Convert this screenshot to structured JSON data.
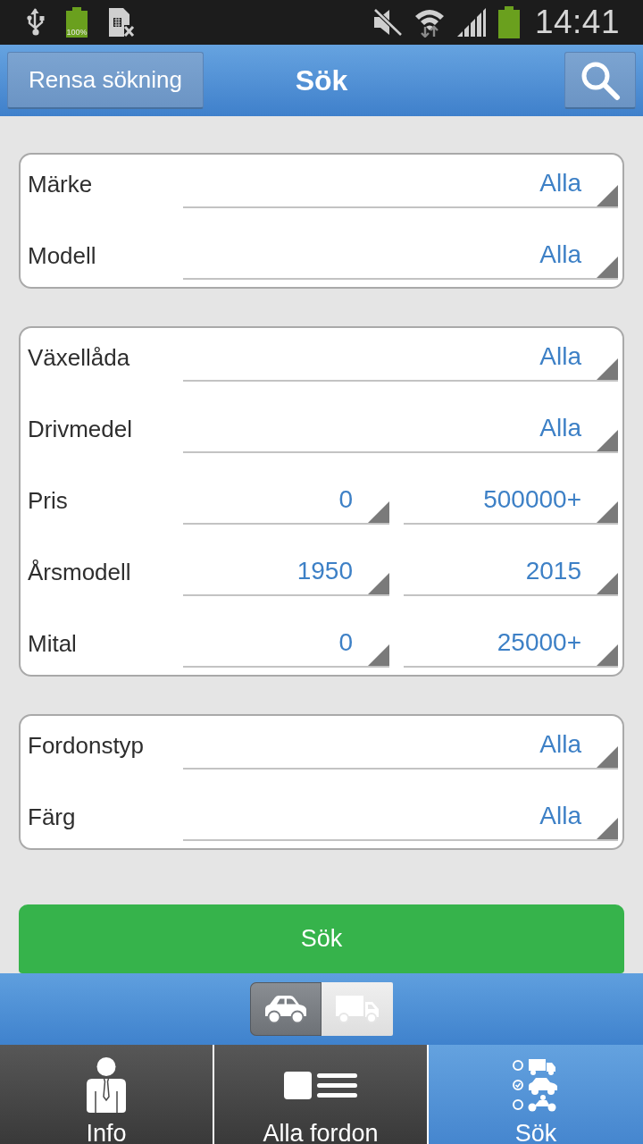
{
  "status_bar": {
    "battery_label": "100%",
    "time": "14:41"
  },
  "header": {
    "clear_button": "Rensa sökning",
    "title": "Sök"
  },
  "groups": [
    {
      "fields": [
        {
          "label": "Märke",
          "values": [
            "Alla"
          ]
        },
        {
          "label": "Modell",
          "values": [
            "Alla"
          ]
        }
      ]
    },
    {
      "fields": [
        {
          "label": "Växellåda",
          "values": [
            "Alla"
          ]
        },
        {
          "label": "Drivmedel",
          "values": [
            "Alla"
          ]
        },
        {
          "label": "Pris",
          "values": [
            "0",
            "500000+"
          ]
        },
        {
          "label": "Årsmodell",
          "values": [
            "1950",
            "2015"
          ]
        },
        {
          "label": "Mital",
          "values": [
            "0",
            "25000+"
          ]
        }
      ]
    },
    {
      "fields": [
        {
          "label": "Fordonstyp",
          "values": [
            "Alla"
          ]
        },
        {
          "label": "Färg",
          "values": [
            "Alla"
          ]
        }
      ]
    }
  ],
  "search_button": "Sök",
  "vehicle_toggle": [
    {
      "kind": "car",
      "selected": true
    },
    {
      "kind": "truck",
      "selected": false
    }
  ],
  "bottom_nav": [
    {
      "kind": "person",
      "label": "Info",
      "selected": false
    },
    {
      "kind": "list",
      "label": "Alla fordon",
      "selected": false
    },
    {
      "kind": "vehicles",
      "label": "Sök",
      "selected": true
    }
  ]
}
